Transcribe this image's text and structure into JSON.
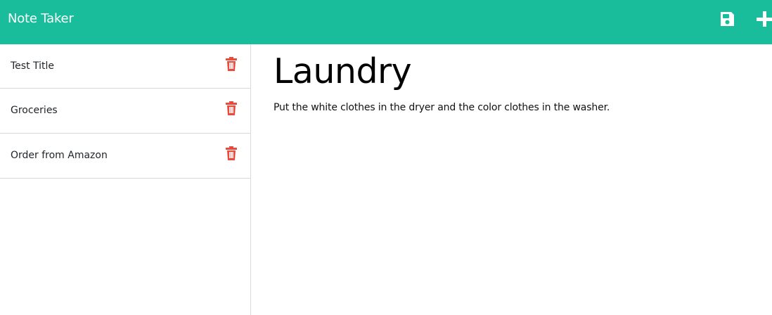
{
  "app": {
    "title": "Note Taker",
    "header_color": "#19bd9b",
    "delete_color": "#e74c3c"
  },
  "header": {
    "save_icon": "save-icon",
    "new_icon": "plus-icon"
  },
  "sidebar": {
    "items": [
      {
        "label": "Test Title",
        "icon": "trash-icon"
      },
      {
        "label": "Groceries",
        "icon": "trash-icon"
      },
      {
        "label": "Order from Amazon",
        "icon": "trash-icon"
      }
    ]
  },
  "main": {
    "title": "Laundry",
    "body": "Put the white clothes in the dryer and the color clothes in the washer."
  }
}
